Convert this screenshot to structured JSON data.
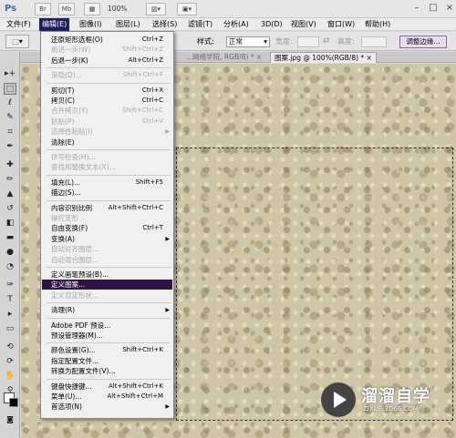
{
  "app": {
    "logo": "Ps",
    "toolbar_buttons": [
      "Br",
      "Mb"
    ],
    "zoom": "100%",
    "window_controls": [
      "–",
      "□",
      "×"
    ]
  },
  "menubar": {
    "items": [
      {
        "label": "文件(F)"
      },
      {
        "label": "编辑(E)",
        "active": true
      },
      {
        "label": "图像(I)"
      },
      {
        "label": "图层(L)"
      },
      {
        "label": "选择(S)"
      },
      {
        "label": "滤镜(T)"
      },
      {
        "label": "分析(A)"
      },
      {
        "label": "3D(D)"
      },
      {
        "label": "视图(V)"
      },
      {
        "label": "窗口(W)"
      },
      {
        "label": "帮助(H)"
      }
    ]
  },
  "options": {
    "style_label": "样式:",
    "style_value": "正常",
    "width_label": "宽度:",
    "height_label": "高度:",
    "refine_button": "调整边缘..."
  },
  "tabs": [
    {
      "label": "...网络学院, RGB/8) *  ×"
    },
    {
      "label": "图案.jpg @ 100%(RGB/8) *  ×",
      "active": true
    }
  ],
  "edit_menu": {
    "items": [
      {
        "label": "还原矩形选框(O)",
        "shortcut": "Ctrl+Z"
      },
      {
        "label": "前进一步(W)",
        "shortcut": "Shift+Ctrl+Z",
        "disabled": true
      },
      {
        "label": "后退一步(K)",
        "shortcut": "Alt+Ctrl+Z"
      },
      {
        "sep": true
      },
      {
        "label": "渐隐(D)...",
        "shortcut": "Shift+Ctrl+F",
        "disabled": true
      },
      {
        "sep": true
      },
      {
        "label": "剪切(T)",
        "shortcut": "Ctrl+X"
      },
      {
        "label": "拷贝(C)",
        "shortcut": "Ctrl+C"
      },
      {
        "label": "合并拷贝(Y)",
        "shortcut": "Shift+Ctrl+C",
        "disabled": true
      },
      {
        "label": "粘贴(P)",
        "shortcut": "Ctrl+V",
        "disabled": true
      },
      {
        "label": "选择性粘贴(I)",
        "arrow": true,
        "disabled": true
      },
      {
        "label": "清除(E)"
      },
      {
        "sep": true
      },
      {
        "label": "拼写检查(H)...",
        "disabled": true
      },
      {
        "label": "查找和替换文本(X)...",
        "disabled": true
      },
      {
        "sep": true
      },
      {
        "label": "填充(L)...",
        "shortcut": "Shift+F5"
      },
      {
        "label": "描边(S)..."
      },
      {
        "sep": true
      },
      {
        "label": "内容识别比例",
        "shortcut": "Alt+Shift+Ctrl+C"
      },
      {
        "label": "操控变形",
        "disabled": true
      },
      {
        "label": "自由变换(F)",
        "shortcut": "Ctrl+T"
      },
      {
        "label": "变换(A)",
        "arrow": true
      },
      {
        "label": "自动对齐图层...",
        "disabled": true
      },
      {
        "label": "自动混合图层...",
        "disabled": true
      },
      {
        "sep": true
      },
      {
        "label": "定义画笔预设(B)..."
      },
      {
        "label": "定义图案...",
        "highlight": true
      },
      {
        "label": "定义自定形状...",
        "disabled": true
      },
      {
        "sep": true
      },
      {
        "label": "清理(R)",
        "arrow": true
      },
      {
        "sep": true
      },
      {
        "label": "Adobe PDF 预设..."
      },
      {
        "label": "预设管理器(M)..."
      },
      {
        "sep": true
      },
      {
        "label": "颜色设置(G)...",
        "shortcut": "Shift+Ctrl+K"
      },
      {
        "label": "指定配置文件..."
      },
      {
        "label": "转换为配置文件(V)..."
      },
      {
        "sep": true
      },
      {
        "label": "键盘快捷键...",
        "shortcut": "Alt+Shift+Ctrl+K"
      },
      {
        "label": "菜单(U)...",
        "shortcut": "Alt+Shift+Ctrl+M"
      },
      {
        "label": "首选项(N)",
        "arrow": true
      }
    ]
  },
  "watermark": {
    "name": "溜溜自学",
    "url": "ZIXUE.3D66.COM"
  }
}
